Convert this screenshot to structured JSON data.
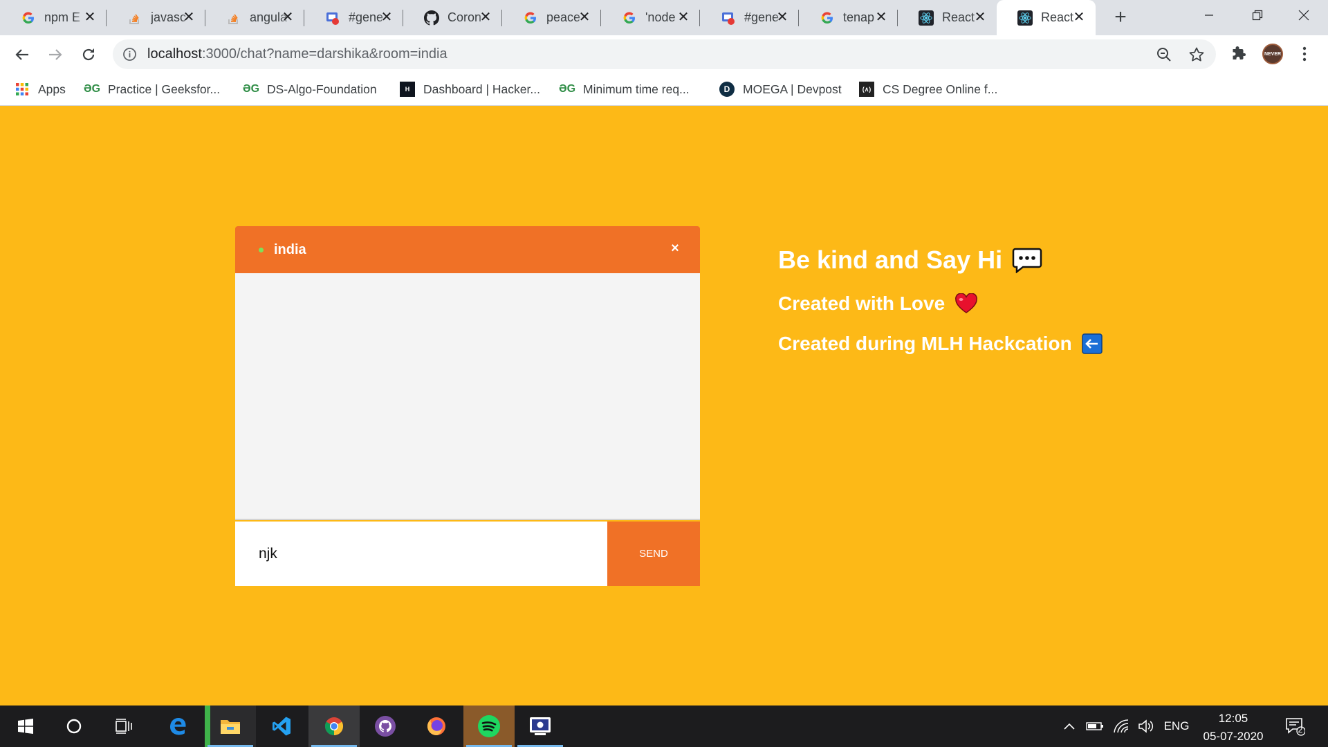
{
  "browser": {
    "tabs": [
      {
        "title": "npm E",
        "icon": "google-icon",
        "active": false
      },
      {
        "title": "javasc",
        "icon": "stackoverflow-icon",
        "active": false
      },
      {
        "title": "angula",
        "icon": "stackoverflow-icon",
        "active": false
      },
      {
        "title": "#gene",
        "icon": "meet-icon",
        "active": false
      },
      {
        "title": "Coron",
        "icon": "github-icon",
        "active": false
      },
      {
        "title": "peace",
        "icon": "google-icon",
        "active": false
      },
      {
        "title": "'node",
        "icon": "google-icon",
        "active": false
      },
      {
        "title": "#gene",
        "icon": "meet-icon",
        "active": false
      },
      {
        "title": "tenap",
        "icon": "google-icon",
        "active": false
      },
      {
        "title": "React",
        "icon": "react-icon",
        "active": false
      },
      {
        "title": "React",
        "icon": "react-icon",
        "active": true
      }
    ],
    "url": {
      "host": "localhost",
      "rest": ":3000/chat?name=darshika&room=india"
    },
    "avatar_text": "NEVER",
    "bookmarks": [
      {
        "label": "Apps",
        "icon": "apps-grid-icon"
      },
      {
        "label": "Practice | Geeksfor...",
        "icon": "geeksforgeeks-icon"
      },
      {
        "label": "DS-Algo-Foundation",
        "icon": "geeksforgeeks-icon"
      },
      {
        "label": "Dashboard | Hacker...",
        "icon": "hackerrank-icon"
      },
      {
        "label": "Minimum time req...",
        "icon": "geeksforgeeks-icon"
      },
      {
        "label": "MOEGA | Devpost",
        "icon": "devpost-icon"
      },
      {
        "label": "CS Degree Online f...",
        "icon": "cs-degree-icon"
      }
    ],
    "gfg_glyph": "ƏG",
    "hr_glyph": "H",
    "dp_glyph": "D",
    "cs_glyph": "(∧)"
  },
  "chat": {
    "room": "india",
    "close_symbol": "×",
    "input_value": "njk",
    "send_label": "Send"
  },
  "side": {
    "line1": "Be kind and Say Hi",
    "line2": "Created with Love",
    "line3": "Created during MLH Hackcation"
  },
  "taskbar": {
    "apps": [
      "windows-start-icon",
      "search-cortana-icon",
      "task-view-icon",
      "edge-icon",
      "file-explorer-icon",
      "vscode-icon",
      "chrome-icon",
      "github-desktop-icon",
      "firefox-icon",
      "spotify-icon",
      "screen-app-icon"
    ],
    "language": "ENG",
    "time": "12:05",
    "date": "05-07-2020",
    "notifications": "2"
  },
  "colors": {
    "page_background": "#fdb917",
    "accent_orange": "#f07126",
    "online_dot": "#7ee05a"
  }
}
